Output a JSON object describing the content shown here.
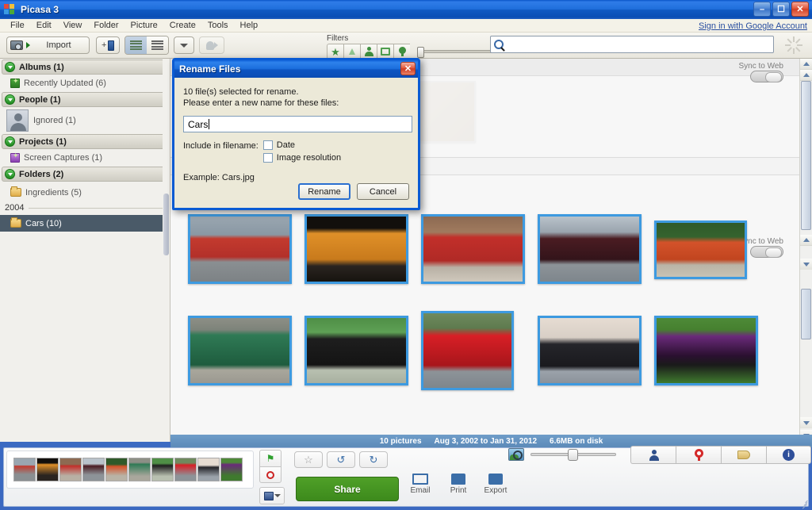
{
  "window": {
    "title": "Picasa 3",
    "minimize": "–",
    "maximize": "☐",
    "close": "✕"
  },
  "menu": [
    "File",
    "Edit",
    "View",
    "Folder",
    "Picture",
    "Create",
    "Tools",
    "Help"
  ],
  "signin": "Sign in with Google Account",
  "toolbar": {
    "import_label": "Import",
    "add_album_icon": "add-album-icon",
    "list_view_icon": "list-view-icon",
    "detail_view_icon": "detail-view-icon",
    "dropdown_icon": "chevron-down-icon",
    "people_icon": "people-tag-icon"
  },
  "filters": {
    "label": "Filters",
    "buttons": [
      "star-filter",
      "upload-filter",
      "face-filter",
      "video-filter",
      "geotag-filter"
    ],
    "slider_value": 0
  },
  "search": {
    "placeholder": "",
    "value": "",
    "icon": "search-icon"
  },
  "sidebar": {
    "sections": [
      {
        "type": "header",
        "label": "Albums (1)",
        "name": "albums"
      },
      {
        "type": "item",
        "label": "Recently Updated (6)",
        "icon": "album-icon",
        "name": "recently-updated"
      },
      {
        "type": "header",
        "label": "People (1)",
        "name": "people"
      },
      {
        "type": "person",
        "label": "Ignored (1)",
        "icon": "avatar-icon",
        "name": "ignored"
      },
      {
        "type": "header",
        "label": "Projects (1)",
        "name": "projects"
      },
      {
        "type": "item",
        "label": "Screen Captures (1)",
        "icon": "album-icon-purple",
        "name": "screen-captures"
      },
      {
        "type": "header",
        "label": "Folders (2)",
        "name": "folders"
      },
      {
        "type": "item",
        "label": "Ingredients (5)",
        "icon": "folder-icon",
        "name": "ingredients"
      },
      {
        "type": "year",
        "label": "2004",
        "name": "year-2004"
      },
      {
        "type": "item-selected",
        "label": "Cars (10)",
        "icon": "folder-icon",
        "name": "cars"
      }
    ]
  },
  "photo_area": {
    "sync_label_1": "Sync to Web",
    "sync_label_2": "Sync to Web",
    "photos_row1": [
      {
        "name": "photo-red-chevelle",
        "c1": "#c33a2e",
        "c2": "#7a2a1e",
        "c3": "#aab0a2"
      },
      {
        "name": "photo-orange-gto",
        "c1": "#e09028",
        "c2": "#1a1410",
        "c3": "#2a2220"
      },
      {
        "name": "photo-red-bel-air",
        "c1": "#c22f2a",
        "c2": "#8d6a52",
        "c3": "#d8cdbe"
      },
      {
        "name": "photo-maroon-chevy",
        "c1": "#4a1c22",
        "c2": "#2a1014",
        "c3": "#9aa2a8"
      },
      {
        "name": "photo-orange-chevelle",
        "c1": "#d4522a",
        "c2": "#2f5a2a",
        "c3": "#c8c2b4"
      }
    ],
    "photos_row2": [
      {
        "name": "photo-green-cadillac",
        "c1": "#2f7a55",
        "c2": "#1e5c3e",
        "c3": "#9aa090"
      },
      {
        "name": "photo-black-model-t",
        "c1": "#1e1e1e",
        "c2": "#3f6f36",
        "c3": "#b8c0b0"
      },
      {
        "name": "photo-red-viper",
        "c1": "#d81f26",
        "c2": "#8a1016",
        "c3": "#8d9398"
      },
      {
        "name": "photo-antique-tourer",
        "c1": "#25252a",
        "c2": "#d8cfc6",
        "c3": "#9ba2aa"
      },
      {
        "name": "photo-purple-hotrod",
        "c1": "#6a2a7a",
        "c2": "#1a1a1a",
        "c3": "#4e8a38"
      }
    ]
  },
  "status": {
    "count": "10 pictures",
    "daterange": "Aug 3, 2002 to Jan 31, 2012",
    "size": "6.6MB on disk"
  },
  "bottom": {
    "star_icon": "star-icon",
    "rotate_left_icon": "rotate-left-icon",
    "rotate_right_icon": "rotate-right-icon",
    "share_label": "Share",
    "email_label": "Email",
    "print_label": "Print",
    "export_label": "Export",
    "email_icon": "envelope-icon",
    "print_icon": "printer-icon",
    "export_icon": "export-folder-icon",
    "zoom_icon": "zoom-photo-icon",
    "zoom_value": 40,
    "right_buttons": [
      "person-tag-button",
      "geotag-button",
      "tags-button",
      "info-button"
    ],
    "pin_icon": "pin-icon",
    "circle-icon": "circle-icon",
    "tray_icon": "tray-icon"
  },
  "dialog": {
    "title": "Rename Files",
    "close": "✕",
    "line1": "10 file(s) selected for rename.",
    "line2": "Please enter a new name for these files:",
    "input_value": "Cars",
    "include_label": "Include in filename:",
    "checkbox_date": "Date",
    "checkbox_resolution": "Image resolution",
    "example": "Example:  Cars.jpg",
    "rename_button": "Rename",
    "cancel_button": "Cancel"
  }
}
